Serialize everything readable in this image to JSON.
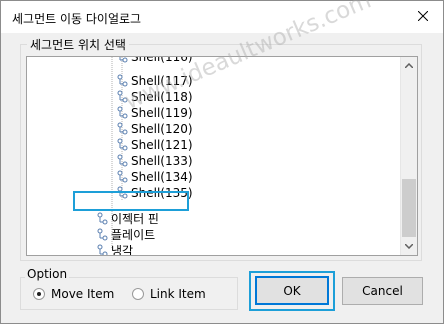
{
  "window": {
    "title": "세그먼트 이동 다이얼로그",
    "close_icon": "close-icon"
  },
  "segment_group": {
    "label": "세그먼트 위치 선택",
    "tree_items": [
      {
        "label": "Shell(116)",
        "level": 2,
        "partial": true
      },
      {
        "label": "Shell(117)",
        "level": 2
      },
      {
        "label": "Shell(118)",
        "level": 2
      },
      {
        "label": "Shell(119)",
        "level": 2
      },
      {
        "label": "Shell(120)",
        "level": 2
      },
      {
        "label": "Shell(121)",
        "level": 2
      },
      {
        "label": "Shell(133)",
        "level": 2
      },
      {
        "label": "Shell(134)",
        "level": 2
      },
      {
        "label": "Shell(135)",
        "level": 2
      },
      {
        "label": "이젝터 핀",
        "level": 1,
        "selected": true
      },
      {
        "label": "플레이트",
        "level": 1
      },
      {
        "label": "냉각",
        "level": 1
      },
      {
        "label": "스프링",
        "level": 1
      }
    ]
  },
  "option_group": {
    "label": "Option",
    "move_item": {
      "label": "Move Item",
      "checked": true
    },
    "link_item": {
      "label": "Link Item",
      "checked": false
    }
  },
  "buttons": {
    "ok": "OK",
    "cancel": "Cancel"
  },
  "watermark": "www.ideaultworks.com",
  "colors": {
    "highlight": "#1d9fd8",
    "focus_border": "#0078d7",
    "dialog_bg": "#f0f0f0"
  }
}
